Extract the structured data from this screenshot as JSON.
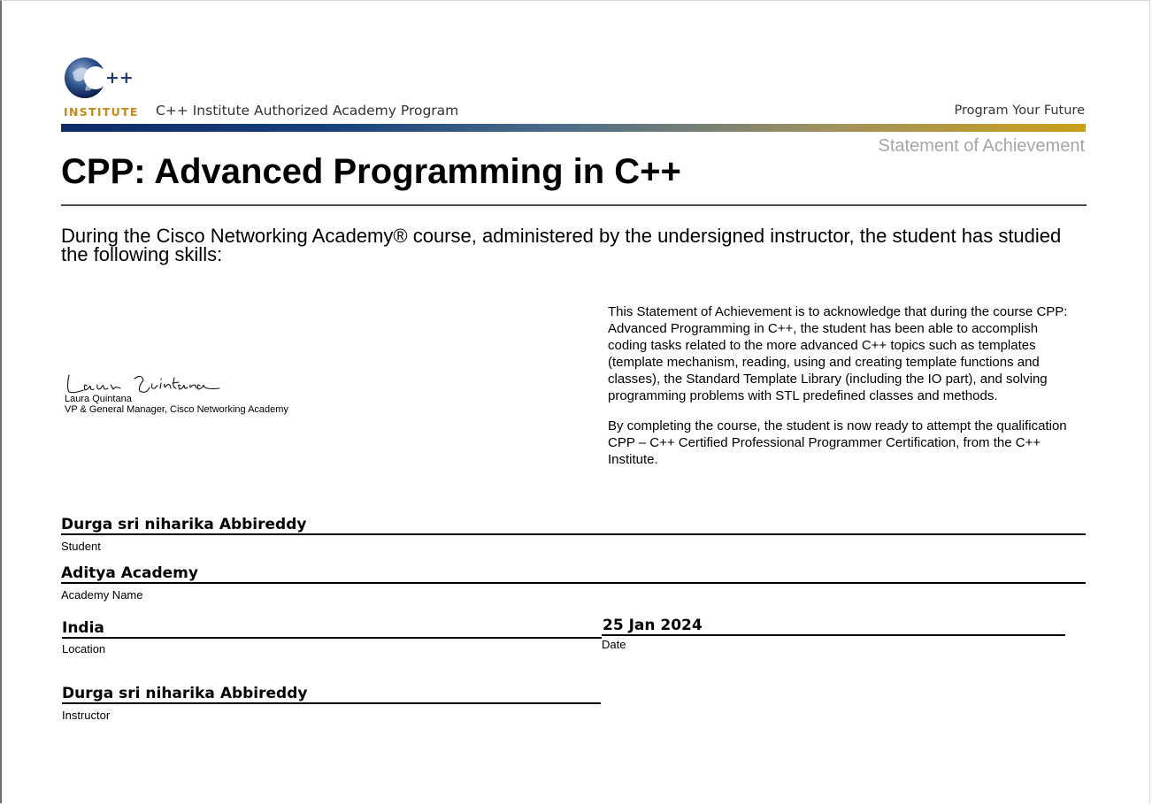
{
  "header": {
    "logo_mark": "C++",
    "logo_word": "INSTITUTE",
    "program": "C++ Institute Authorized Academy Program",
    "tagline": "Program Your Future",
    "document_type": "Statement of Achievement",
    "colors": {
      "bar_start": "#0e2b66",
      "bar_end": "#c9a01a",
      "logo_gold": "#c28a1a"
    }
  },
  "course": {
    "title": "CPP: Advanced Programming in C++",
    "intro": "During the Cisco Networking Academy® course, administered by the undersigned instructor, the student has studied the following skills:"
  },
  "signatory": {
    "name": "Laura Quintana",
    "role": "VP & General Manager, Cisco Networking Academy"
  },
  "description": {
    "paragraph1": "This Statement of Achievement is to acknowledge that during the course CPP: Advanced Programming in C++, the student has been able to accomplish coding tasks related to the more advanced C++ topics such as templates (template mechanism, reading, using and creating template functions and classes), the Standard Template Library (including the IO part), and solving programming problems with STL predefined classes and methods.",
    "paragraph2": "By completing the course, the student is now ready to attempt the qualification CPP – C++ Certified Professional Programmer Certification, from the C++ Institute."
  },
  "fields": {
    "student": {
      "value": "Durga sri niharika Abbireddy",
      "label": "Student"
    },
    "academy": {
      "value": "Aditya Academy",
      "label": "Academy Name"
    },
    "location": {
      "value": "India",
      "label": "Location"
    },
    "date": {
      "value": "25 Jan 2024",
      "label": "Date"
    },
    "instructor": {
      "value": "Durga sri niharika Abbireddy",
      "label": "Instructor"
    }
  }
}
